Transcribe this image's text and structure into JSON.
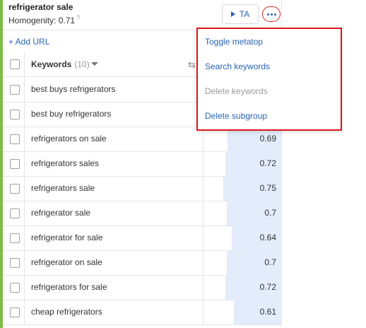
{
  "header": {
    "title": "refrigerator sale",
    "homogeneity_label": "Homogenity: 0.71",
    "homogeneity_hint": "?"
  },
  "toolbar": {
    "ta_label": "TA",
    "ta_icon": "play-icon",
    "more_icon": "more-dots-icon"
  },
  "add_url_label": "+ Add URL",
  "table": {
    "keywords_header": "Keywords",
    "keywords_count": "(10)",
    "sort_icon": "sort-arrow-icon",
    "swap_icon": "swap-icon",
    "rows": [
      {
        "keyword": "best buys refrigerators",
        "value": "",
        "fill": 0.0
      },
      {
        "keyword": "best buy refrigerators",
        "value": "",
        "fill": 0.0
      },
      {
        "keyword": "refrigerators on sale",
        "value": "0.69",
        "fill": 0.69
      },
      {
        "keyword": "refrigerators sales",
        "value": "0.72",
        "fill": 0.72
      },
      {
        "keyword": "refrigerators sale",
        "value": "0.75",
        "fill": 0.75
      },
      {
        "keyword": "refrigerator sale",
        "value": "0.7",
        "fill": 0.7
      },
      {
        "keyword": "refrigerator for sale",
        "value": "0.64",
        "fill": 0.64
      },
      {
        "keyword": "refrigerator on sale",
        "value": "0.7",
        "fill": 0.7
      },
      {
        "keyword": "refrigerators for sale",
        "value": "0.72",
        "fill": 0.72
      },
      {
        "keyword": "cheap refrigerators",
        "value": "0.61",
        "fill": 0.61
      }
    ]
  },
  "menu": {
    "items": [
      {
        "label": "Toggle metatop",
        "enabled": true
      },
      {
        "label": "Search keywords",
        "enabled": true
      },
      {
        "label": "Delete keywords",
        "enabled": false
      },
      {
        "label": "Delete subgroup",
        "enabled": true
      }
    ]
  },
  "colors": {
    "accent": "#2a63b3",
    "highlight": "#d9161a",
    "group_bar": "#7cbc45",
    "value_fill": "#e3ecfb"
  }
}
